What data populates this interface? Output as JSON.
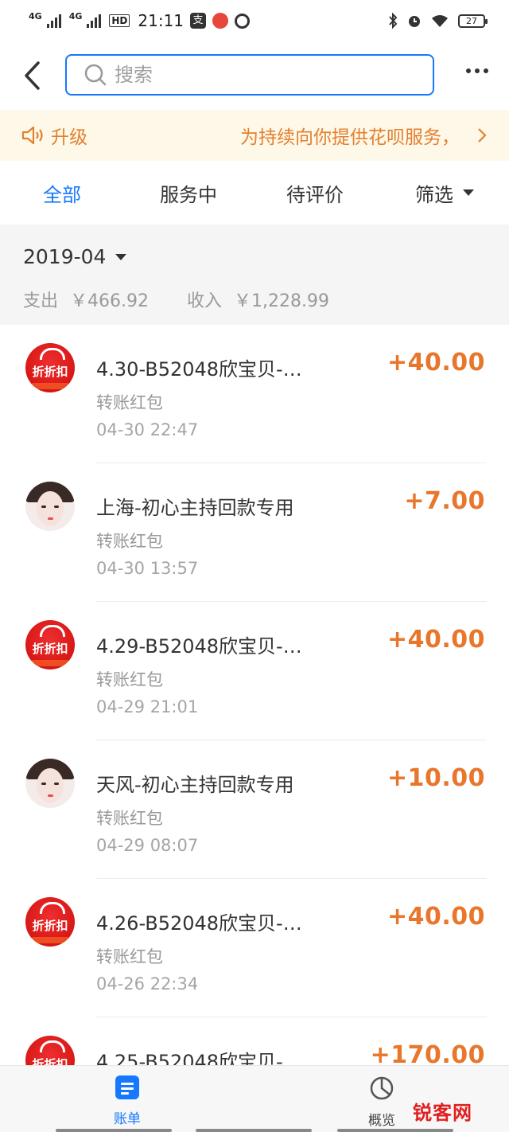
{
  "status_bar": {
    "network1": "4G",
    "network2": "4G",
    "hd": "HD",
    "time": "21:11",
    "app_icon_label": "支",
    "battery": "27"
  },
  "search": {
    "placeholder": "搜索"
  },
  "notice": {
    "left_text": "升级",
    "right_text": "为持续向你提供花呗服务，"
  },
  "tabs": [
    {
      "label": "全部",
      "active": true
    },
    {
      "label": "服务中"
    },
    {
      "label": "待评价"
    },
    {
      "label": "筛选"
    }
  ],
  "month": {
    "label": "2019-04",
    "expense_label": "支出",
    "expense_value": "￥466.92",
    "income_label": "收入",
    "income_value": "￥1,228.99"
  },
  "transactions": [
    {
      "avatar": "shop",
      "avatar_text": "折折扣",
      "title": "4.30-B52048欣宝贝-…",
      "subtitle": "转账红包",
      "time": "04-30  22:47",
      "amount": "+40.00"
    },
    {
      "avatar": "person",
      "title": "上海-初心主持回款专用",
      "subtitle": "转账红包",
      "time": "04-30  13:57",
      "amount": "+7.00"
    },
    {
      "avatar": "shop",
      "avatar_text": "折折扣",
      "title": "4.29-B52048欣宝贝-…",
      "subtitle": "转账红包",
      "time": "04-29  21:01",
      "amount": "+40.00"
    },
    {
      "avatar": "person",
      "title": "天风-初心主持回款专用",
      "subtitle": "转账红包",
      "time": "04-29  08:07",
      "amount": "+10.00"
    },
    {
      "avatar": "shop",
      "avatar_text": "折折扣",
      "title": "4.26-B52048欣宝贝-…",
      "subtitle": "转账红包",
      "time": "04-26  22:34",
      "amount": "+40.00"
    },
    {
      "avatar": "shop",
      "avatar_text": "折折扣",
      "title": "4.25-B52048欣宝贝-…",
      "subtitle": "",
      "time": "",
      "amount": "+170.00"
    }
  ],
  "bottom_tabs": {
    "bill": "账单",
    "overview": "概览"
  },
  "watermark": "锐客网",
  "colors": {
    "accent": "#1677ff",
    "amount": "#e8762b",
    "notice_bg": "#fef8e9",
    "notice_text": "#e3802f"
  }
}
